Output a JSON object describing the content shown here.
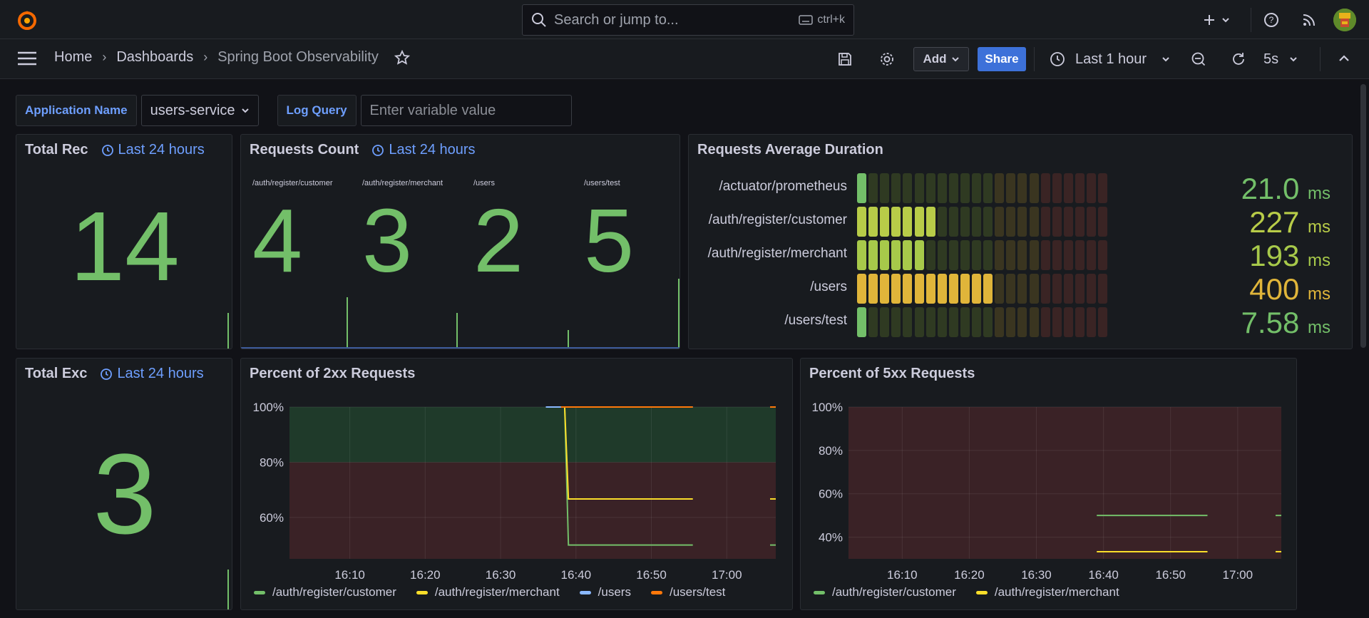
{
  "topbar": {
    "search_placeholder": "Search or jump to...",
    "search_shortcut": "ctrl+k",
    "icons": [
      "grafana-logo-icon",
      "search-icon",
      "keyboard-icon",
      "plus-icon",
      "chevron-down-icon",
      "help-icon",
      "rss-icon",
      "avatar"
    ]
  },
  "nav": {
    "breadcrumbs": [
      "Home",
      "Dashboards",
      "Spring Boot Observability"
    ],
    "add_label": "Add",
    "share_label": "Share",
    "time_range": "Last 1 hour",
    "refresh_interval": "5s"
  },
  "variables": {
    "app_label": "Application Name",
    "app_value": "users-service",
    "log_label": "Log Query",
    "log_placeholder": "Enter variable value"
  },
  "panels": {
    "total_requests": {
      "title": "Total Rec",
      "time_info": "Last 24 hours",
      "value": "14"
    },
    "requests_count": {
      "title": "Requests Count",
      "time_info": "Last 24 hours",
      "items": [
        {
          "label": "/auth/register/customer",
          "value": "4"
        },
        {
          "label": "/auth/register/merchant",
          "value": "3"
        },
        {
          "label": "/users",
          "value": "2"
        },
        {
          "label": "/users/test",
          "value": "5"
        }
      ]
    },
    "avg_duration": {
      "title": "Requests Average Duration",
      "rows": [
        {
          "label": "/actuator/prometheus",
          "value": "21.0",
          "unit": "ms",
          "cells": 1,
          "color": "#73bf69"
        },
        {
          "label": "/auth/register/customer",
          "value": "227",
          "unit": "ms",
          "cells": 7,
          "color": "#b8cc48"
        },
        {
          "label": "/auth/register/merchant",
          "value": "193",
          "unit": "ms",
          "cells": 6,
          "color": "#a7c94a"
        },
        {
          "label": "/users",
          "value": "400",
          "unit": "ms",
          "cells": 12,
          "color": "#e0b53a"
        },
        {
          "label": "/users/test",
          "value": "7.58",
          "unit": "ms",
          "cells": 1,
          "color": "#73bf69"
        }
      ],
      "total_cells": 22
    },
    "total_exceptions": {
      "title": "Total Exc",
      "time_info": "Last 24 hours",
      "value": "3"
    },
    "pct_2xx": {
      "title": "Percent of 2xx Requests",
      "legend": [
        {
          "name": "/auth/register/customer",
          "color": "#73bf69"
        },
        {
          "name": "/auth/register/merchant",
          "color": "#fade2a"
        },
        {
          "name": "/users",
          "color": "#8ab8ff"
        },
        {
          "name": "/users/test",
          "color": "#ff780a"
        }
      ]
    },
    "pct_5xx": {
      "title": "Percent of 5xx Requests",
      "legend": [
        {
          "name": "/auth/register/customer",
          "color": "#73bf69"
        },
        {
          "name": "/auth/register/merchant",
          "color": "#fade2a"
        }
      ]
    }
  },
  "chart_data": [
    {
      "type": "line",
      "title": "Percent of 2xx Requests",
      "x_ticks": [
        "16:10",
        "16:20",
        "16:30",
        "16:40",
        "16:50",
        "17:00"
      ],
      "y_ticks": [
        "100%",
        "80%",
        "60%"
      ],
      "ylim": [
        45,
        100
      ],
      "thresholds": [
        {
          "from": 80,
          "to": 100,
          "color": "#1f3a2a"
        },
        {
          "from": 45,
          "to": 80,
          "color": "#3a2226"
        }
      ],
      "series": [
        {
          "name": "/auth/register/customer",
          "points": [
            [
              "16:38",
              100
            ],
            [
              "16:38.5",
              100
            ],
            [
              "16:39",
              50
            ],
            [
              "16:55.5",
              50
            ]
          ]
        },
        {
          "name": "/auth/register/merchant",
          "points": [
            [
              "16:38",
              100
            ],
            [
              "16:38.5",
              100
            ],
            [
              "16:39",
              66.7
            ],
            [
              "16:55.5",
              66.7
            ]
          ]
        },
        {
          "name": "/users",
          "points": [
            [
              "16:36",
              100
            ],
            [
              "16:55.5",
              100
            ]
          ]
        },
        {
          "name": "/users/test",
          "points": [
            [
              "16:38",
              100
            ],
            [
              "16:55.5",
              100
            ]
          ]
        }
      ]
    },
    {
      "type": "line",
      "title": "Percent of 5xx Requests",
      "x_ticks": [
        "16:10",
        "16:20",
        "16:30",
        "16:40",
        "16:50",
        "17:00"
      ],
      "y_ticks": [
        "100%",
        "80%",
        "60%",
        "40%"
      ],
      "ylim": [
        30,
        100
      ],
      "series": [
        {
          "name": "/auth/register/customer",
          "points": [
            [
              "16:39",
              50
            ],
            [
              "16:55.5",
              50
            ]
          ]
        },
        {
          "name": "/auth/register/merchant",
          "points": [
            [
              "16:39",
              33.3
            ],
            [
              "16:55.5",
              33.3
            ]
          ]
        }
      ]
    }
  ]
}
